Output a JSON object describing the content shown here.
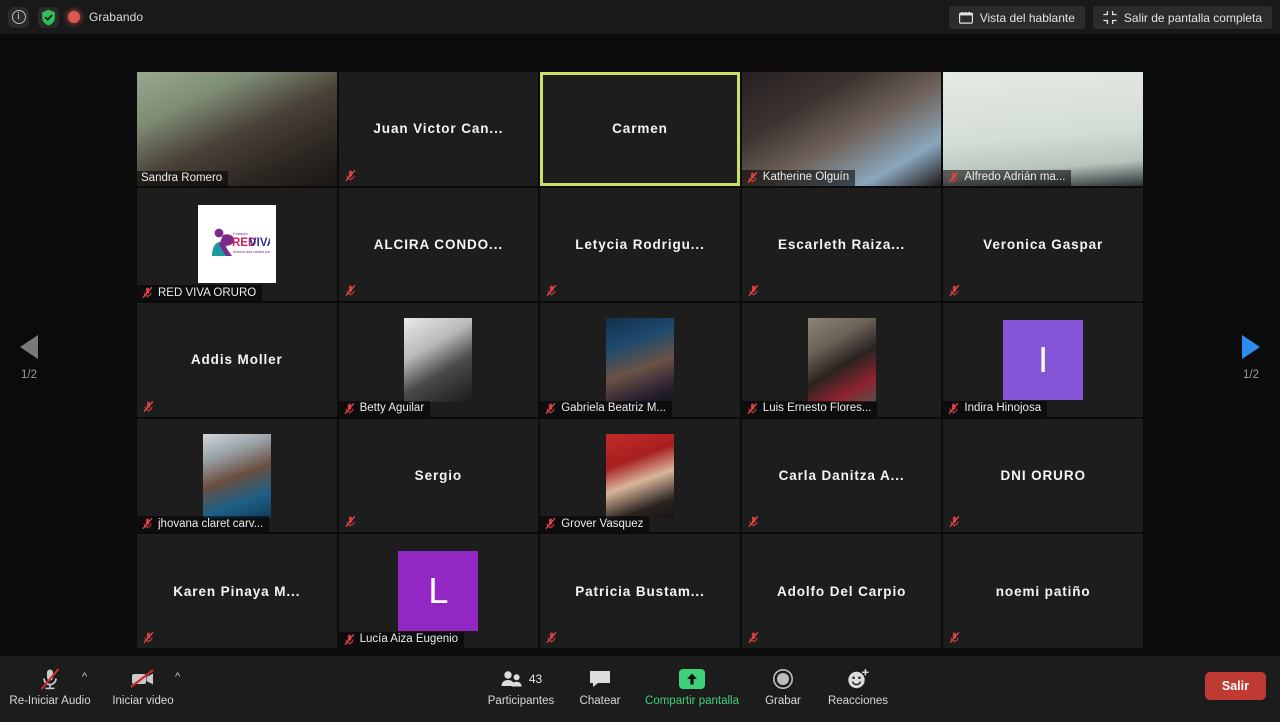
{
  "topbar": {
    "info_icon": "info-icon",
    "encryption_icon": "shield-check-icon",
    "recording_label": "Grabando",
    "speaker_view_label": "Vista del hablante",
    "speaker_view_icon": "speaker-view-icon",
    "exit_fullscreen_label": "Salir de pantalla completa",
    "exit_fullscreen_icon": "exit-fullscreen-icon"
  },
  "pager": {
    "prev_icon": "chevron-left-icon",
    "next_icon": "chevron-right-icon",
    "prev_page_label": "1/2",
    "next_page_label": "1/2",
    "prev_enabled": false,
    "next_enabled": true,
    "prev_color": "#7a7a7a",
    "next_color": "#2d8cf0"
  },
  "grid": {
    "columns": 5,
    "rows": 5,
    "active_speaker": "Carmen",
    "active_border_color": "#c9e265",
    "participants": [
      {
        "name": "Sandra Romero",
        "display": "namebar",
        "muted": false,
        "media": "video",
        "video": "sandra"
      },
      {
        "name": "Juan Victor Can...",
        "display": "center",
        "muted": true,
        "media": "none"
      },
      {
        "name": "Carmen",
        "display": "center",
        "muted": false,
        "media": "none",
        "active": true
      },
      {
        "name": "Katherine Olguín",
        "display": "namebar",
        "muted": true,
        "media": "video",
        "video": "katherine"
      },
      {
        "name": "Alfredo Adrián ma...",
        "display": "namebar",
        "muted": true,
        "media": "video",
        "video": "alfredo"
      },
      {
        "name": "RED VIVA ORURO",
        "display": "namebar",
        "muted": true,
        "media": "logo",
        "logo_text": "RED VIVA"
      },
      {
        "name": "ALCIRA CONDO...",
        "display": "center",
        "muted": true,
        "media": "none"
      },
      {
        "name": "Letycia Rodrigu...",
        "display": "center",
        "muted": true,
        "media": "none"
      },
      {
        "name": "Escarleth Raiza...",
        "display": "center",
        "muted": true,
        "media": "none"
      },
      {
        "name": "Veronica Gaspar",
        "display": "center",
        "muted": true,
        "media": "none"
      },
      {
        "name": "Addis Moller",
        "display": "center",
        "muted": true,
        "media": "none"
      },
      {
        "name": "Betty Aguilar",
        "display": "namebar",
        "muted": true,
        "media": "photo",
        "photo": "betty"
      },
      {
        "name": "Gabriela Beatriz M...",
        "display": "namebar",
        "muted": true,
        "media": "photo",
        "photo": "gabriela"
      },
      {
        "name": "Luis Ernesto Flores...",
        "display": "namebar",
        "muted": true,
        "media": "photo",
        "photo": "luis"
      },
      {
        "name": "Indira Hinojosa",
        "display": "namebar",
        "muted": true,
        "media": "initial",
        "initial": "I",
        "avatar_color": "#8455d6"
      },
      {
        "name": "jhovana claret carv...",
        "display": "namebar",
        "muted": true,
        "media": "photo",
        "photo": "jhovana"
      },
      {
        "name": "Sergio",
        "display": "center",
        "muted": true,
        "media": "none"
      },
      {
        "name": "Grover Vasquez",
        "display": "namebar",
        "muted": true,
        "media": "photo",
        "photo": "grover"
      },
      {
        "name": "Carla Danitza A...",
        "display": "center",
        "muted": true,
        "media": "none"
      },
      {
        "name": "DNI ORURO",
        "display": "center",
        "muted": true,
        "media": "none"
      },
      {
        "name": "Karen Pinaya M...",
        "display": "center",
        "muted": true,
        "media": "none"
      },
      {
        "name": "Lucía Aiza Eugenio",
        "display": "namebar",
        "muted": true,
        "media": "initial",
        "initial": "L",
        "avatar_color": "#9327c4"
      },
      {
        "name": "Patricia Bustam...",
        "display": "center",
        "muted": true,
        "media": "none"
      },
      {
        "name": "Adolfo Del Carpio",
        "display": "center",
        "muted": true,
        "media": "none"
      },
      {
        "name": "noemi patiño",
        "display": "center",
        "muted": true,
        "media": "none"
      }
    ]
  },
  "toolbar": {
    "audio_label": "Re-Iniciar Audio",
    "audio_icon": "mic-muted-icon",
    "audio_caret": "^",
    "video_label": "Iniciar video",
    "video_icon": "camera-muted-icon",
    "video_caret": "^",
    "participants_label": "Participantes",
    "participants_icon": "participants-icon",
    "participants_count": "43",
    "chat_label": "Chatear",
    "chat_icon": "chat-bubble-icon",
    "share_label": "Compartir pantalla",
    "share_icon": "share-screen-icon",
    "share_color": "#3ed17a",
    "record_label": "Grabar",
    "record_icon": "record-circle-icon",
    "reactions_label": "Reacciones",
    "reactions_icon": "reactions-smiley-icon",
    "leave_label": "Salir",
    "leave_color": "#c03a34"
  }
}
